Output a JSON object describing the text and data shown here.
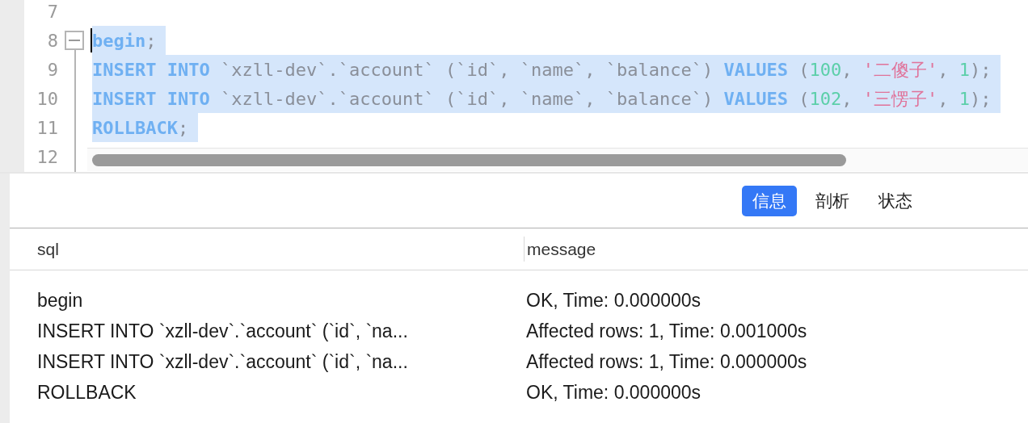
{
  "editor": {
    "lines": [
      {
        "number": "7",
        "selected": false
      },
      {
        "number": "8",
        "selected": true,
        "fold_expanded": true,
        "cursor": true,
        "tokens": [
          {
            "kind": "keyword",
            "text": "begin"
          },
          {
            "kind": "plain",
            "text": ";"
          }
        ]
      },
      {
        "number": "9",
        "selected": true,
        "tokens": [
          {
            "kind": "keyword",
            "text": "INSERT INTO"
          },
          {
            "kind": "plain",
            "text": " `xzll-dev`.`account` (`id`, `name`, `balance`) "
          },
          {
            "kind": "keyword",
            "text": "VALUES"
          },
          {
            "kind": "plain",
            "text": " ("
          },
          {
            "kind": "number",
            "text": "100"
          },
          {
            "kind": "plain",
            "text": ", "
          },
          {
            "kind": "string",
            "text": "'二傻子'"
          },
          {
            "kind": "plain",
            "text": ", "
          },
          {
            "kind": "number",
            "text": "1"
          },
          {
            "kind": "plain",
            "text": ");"
          }
        ]
      },
      {
        "number": "10",
        "selected": true,
        "tokens": [
          {
            "kind": "keyword",
            "text": "INSERT INTO"
          },
          {
            "kind": "plain",
            "text": " `xzll-dev`.`account` (`id`, `name`, `balance`) "
          },
          {
            "kind": "keyword",
            "text": "VALUES"
          },
          {
            "kind": "plain",
            "text": " ("
          },
          {
            "kind": "number",
            "text": "102"
          },
          {
            "kind": "plain",
            "text": ", "
          },
          {
            "kind": "string",
            "text": "'三愣子'"
          },
          {
            "kind": "plain",
            "text": ", "
          },
          {
            "kind": "number",
            "text": "1"
          },
          {
            "kind": "plain",
            "text": ");"
          }
        ]
      },
      {
        "number": "11",
        "selected": true,
        "tokens": [
          {
            "kind": "keyword",
            "text": "ROLLBACK"
          },
          {
            "kind": "plain",
            "text": ";"
          }
        ]
      },
      {
        "number": "12",
        "selected": false
      }
    ]
  },
  "tabs": [
    {
      "label": "信息",
      "selected": true
    },
    {
      "label": "剖析",
      "selected": false
    },
    {
      "label": "状态",
      "selected": false
    }
  ],
  "table": {
    "columns": [
      "sql",
      "message"
    ],
    "rows": [
      [
        "begin",
        "OK, Time: 0.000000s"
      ],
      [
        "INSERT INTO `xzll-dev`.`account` (`id`, `na...",
        "Affected rows: 1, Time: 0.001000s"
      ],
      [
        "INSERT INTO `xzll-dev`.`account` (`id`, `na...",
        "Affected rows: 1, Time: 0.000000s"
      ],
      [
        "ROLLBACK",
        "OK, Time: 0.000000s"
      ]
    ]
  }
}
